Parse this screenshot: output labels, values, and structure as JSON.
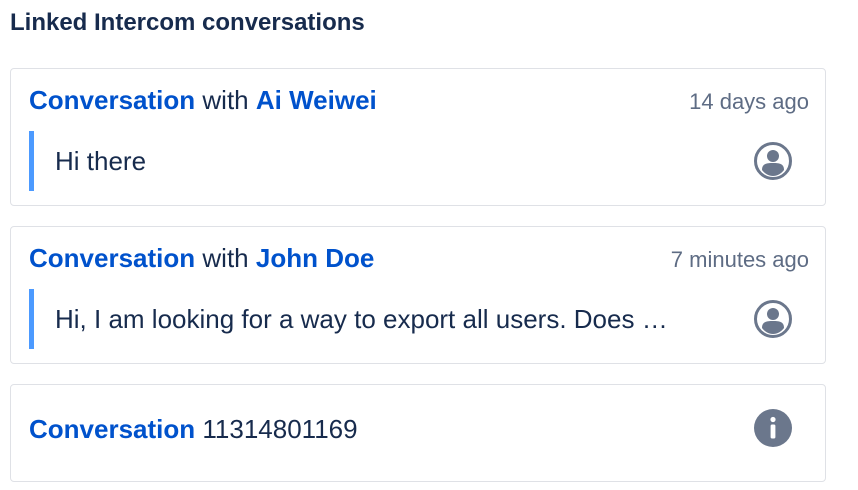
{
  "panel": {
    "title": "Linked Intercom conversations"
  },
  "conversations": [
    {
      "link_label": "Conversation",
      "connector": "with",
      "contact": "Ai Weiwei",
      "timestamp": "14 days ago",
      "message": "Hi there",
      "icon": "user-avatar-icon"
    },
    {
      "link_label": "Conversation",
      "connector": "with",
      "contact": "John Doe",
      "timestamp": "7 minutes ago",
      "message": "Hi, I am looking for a way to export all users. Does …",
      "icon": "user-avatar-icon"
    },
    {
      "link_label": "Conversation",
      "conversation_id": "11314801169",
      "icon": "info-icon"
    }
  ],
  "colors": {
    "link": "#0052cc",
    "text": "#172b4d",
    "muted": "#5e6c84",
    "quote_bar": "#4c9aff",
    "icon": "#6b778c",
    "border": "#dfe1e6"
  }
}
